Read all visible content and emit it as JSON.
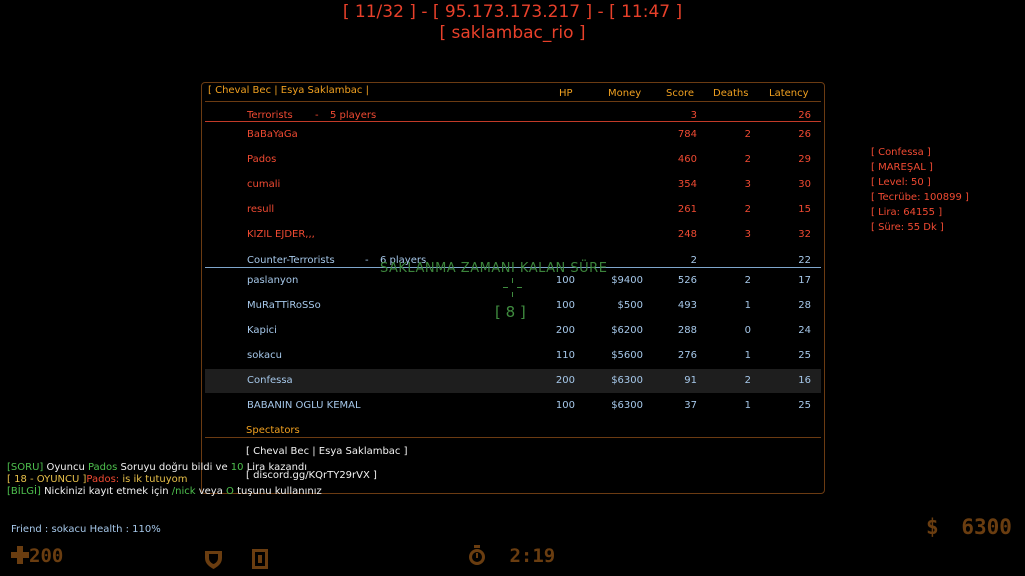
{
  "server": {
    "line1": "[ 11/32 ] - [ 95.173.173.217 ] - [ 11:47 ]",
    "line2": "[ saklambac_rio ]"
  },
  "scoreboard": {
    "title": "[ Cheval Bec | Esya Saklambac |",
    "columns": {
      "hp": "HP",
      "money": "Money",
      "score": "Score",
      "deaths": "Deaths",
      "latency": "Latency"
    },
    "terrorists": {
      "label": "Terrorists",
      "dash": "-",
      "count": "5 players",
      "score": "3",
      "latency": "26",
      "players": [
        {
          "name": "BaBaYaGa",
          "hp": "",
          "money": "",
          "score": "784",
          "deaths": "2",
          "latency": "26"
        },
        {
          "name": "Pados",
          "hp": "",
          "money": "",
          "score": "460",
          "deaths": "2",
          "latency": "29"
        },
        {
          "name": "cumali",
          "hp": "",
          "money": "",
          "score": "354",
          "deaths": "3",
          "latency": "30"
        },
        {
          "name": "resull",
          "hp": "",
          "money": "",
          "score": "261",
          "deaths": "2",
          "latency": "15"
        },
        {
          "name": "KIZIL EJDER,,,",
          "hp": "",
          "money": "",
          "score": "248",
          "deaths": "3",
          "latency": "32"
        }
      ]
    },
    "counter_terrorists": {
      "label": "Counter-Terrorists",
      "dash": "-",
      "count": "6 players",
      "score": "2",
      "latency": "22",
      "players": [
        {
          "name": "paslanyon",
          "hp": "100",
          "money": "$9400",
          "score": "526",
          "deaths": "2",
          "latency": "17"
        },
        {
          "name": "MuRaTTiRoSSo",
          "hp": "100",
          "money": "$500",
          "score": "493",
          "deaths": "1",
          "latency": "28"
        },
        {
          "name": "Kapici",
          "hp": "200",
          "money": "$6200",
          "score": "288",
          "deaths": "0",
          "latency": "24"
        },
        {
          "name": "sokacu",
          "hp": "110",
          "money": "$5600",
          "score": "276",
          "deaths": "1",
          "latency": "25"
        },
        {
          "name": "Confessa",
          "hp": "200",
          "money": "$6300",
          "score": "91",
          "deaths": "2",
          "latency": "16"
        },
        {
          "name": "BABANIN OGLU KEMAL",
          "hp": "100",
          "money": "$6300",
          "score": "37",
          "deaths": "1",
          "latency": "25"
        }
      ]
    },
    "spectators_label": "Spectators",
    "footer": {
      "line1": "[ Cheval Bec | Esya Saklambac ]",
      "line2": "[ discord.gg/KQrTY29rVX ]"
    }
  },
  "hide_timer": {
    "title": "SAKLANMA ZAMANI KALAN SÜRE",
    "value": "[ 8 ]"
  },
  "player_info": [
    "[ Confessa ]",
    "[ MAREŞAL ]",
    "[ Level: 50 ]",
    "[ Tecrübe: 100899 ]",
    "[ Lira: 64155 ]",
    "[ Süre: 55 Dk ]"
  ],
  "chat": [
    {
      "tag": "[SORU]",
      "p1": " Oyuncu ",
      "name": "Pados",
      "p2": " Soruyu doğru bildi ve ",
      "num": "10",
      "p3": " Lira kazandı"
    },
    {
      "tag": "[ 18 - OYUNCU ]",
      "name": "Pados:",
      "msg": " is ik tutuyom"
    },
    {
      "tag": "[BİLGİ]",
      "p1": " Nickinizi kayıt etmek için ",
      "cmd": "/nick",
      "p2": " veya ",
      "key": "O",
      "p3": " tuşunu kullanınız"
    }
  ],
  "friend_info": "Friend : sokacu  Health : 110%",
  "hud": {
    "health": "200",
    "money": "6300",
    "timer": "2:19",
    "money_symbol": "$",
    "health_icon": "cross-icon",
    "armor_icon": "shield-icon",
    "c4_icon": "c4-icon",
    "timer_icon": "stopwatch-icon",
    "color": "#6a3d10"
  },
  "colors": {
    "terrorist": "#f04a32",
    "counter_terrorist": "#a6c8ea",
    "header": "#f0a020",
    "timer": "#3f8c3f"
  }
}
